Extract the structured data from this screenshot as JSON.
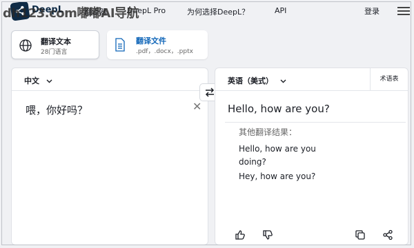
{
  "header": {
    "watermark": "dh123.com嘟嘟AI导航",
    "brand": "DeepL",
    "nav_translator": "翻译器",
    "nav_pro": "DeepL Pro",
    "nav_why": "为何选择DeepL？",
    "nav_api": "API",
    "login": "登录"
  },
  "modes": [
    {
      "title": "翻译文本",
      "subtitle": "28门语言",
      "icon": "globe-icon"
    },
    {
      "title": "翻译文件",
      "subtitle": ".pdf，.docx，.pptx",
      "icon": "document-icon"
    }
  ],
  "source": {
    "language": "中文",
    "text": "喂，你好吗？",
    "clear_icon": "close-icon"
  },
  "target": {
    "language": "英语（美式）",
    "glossary": "术语表",
    "text": "Hello, how are you?",
    "alternatives_title": "其他翻译结果：",
    "alternatives": [
      "Hello, how are you doing?",
      "Hey, how are you?"
    ]
  },
  "colors": {
    "brand": "#0f2b46",
    "link": "#0f65b8",
    "background": "#f0f1f4"
  }
}
